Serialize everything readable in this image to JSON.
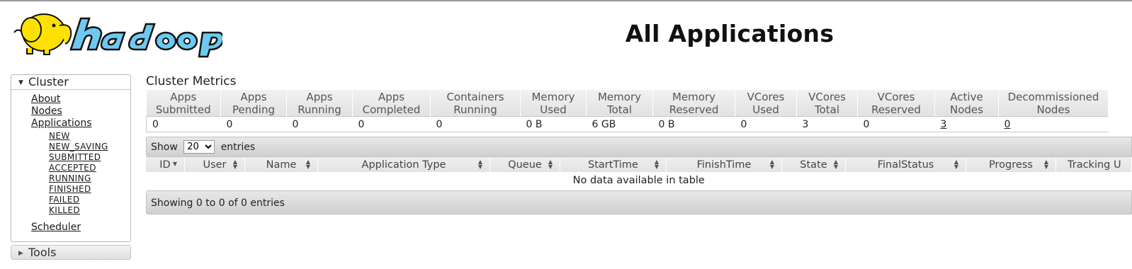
{
  "header": {
    "logo_text": "hadoop",
    "title": "All Applications"
  },
  "nav": {
    "cluster_label": "Cluster",
    "cluster_links": {
      "about": "About",
      "nodes": "Nodes",
      "applications": "Applications",
      "scheduler": "Scheduler"
    },
    "app_states": [
      "NEW",
      "NEW_SAVING",
      "SUBMITTED",
      "ACCEPTED",
      "RUNNING",
      "FINISHED",
      "FAILED",
      "KILLED"
    ],
    "tools_label": "Tools"
  },
  "metrics": {
    "caption": "Cluster Metrics",
    "columns": [
      {
        "h1": "Apps",
        "h2": "Submitted",
        "value": "0"
      },
      {
        "h1": "Apps",
        "h2": "Pending",
        "value": "0"
      },
      {
        "h1": "Apps",
        "h2": "Running",
        "value": "0"
      },
      {
        "h1": "Apps",
        "h2": "Completed",
        "value": "0"
      },
      {
        "h1": "Containers",
        "h2": "Running",
        "value": "0"
      },
      {
        "h1": "Memory",
        "h2": "Used",
        "value": "0 B"
      },
      {
        "h1": "Memory",
        "h2": "Total",
        "value": "6 GB"
      },
      {
        "h1": "Memory",
        "h2": "Reserved",
        "value": "0 B"
      },
      {
        "h1": "VCores",
        "h2": "Used",
        "value": "0"
      },
      {
        "h1": "VCores",
        "h2": "Total",
        "value": "3"
      },
      {
        "h1": "VCores",
        "h2": "Reserved",
        "value": "0"
      },
      {
        "h1": "Active",
        "h2": "Nodes",
        "value": "3"
      },
      {
        "h1": "Decommissioned",
        "h2": "Nodes",
        "value": "0"
      }
    ]
  },
  "apps_table": {
    "show_label": "Show",
    "page_size": "20",
    "page_size_options": [
      "20"
    ],
    "entries_label": "entries",
    "columns": [
      "ID",
      "User",
      "Name",
      "Application Type",
      "Queue",
      "StartTime",
      "FinishTime",
      "State",
      "FinalStatus",
      "Progress",
      "Tracking U"
    ],
    "empty_message": "No data available in table",
    "info": "Showing 0 to 0 of 0 entries"
  },
  "colors": {
    "logo_yellow": "#ffe100",
    "logo_blue": "#66c4f0",
    "header_gray": "#e6e6e6"
  }
}
